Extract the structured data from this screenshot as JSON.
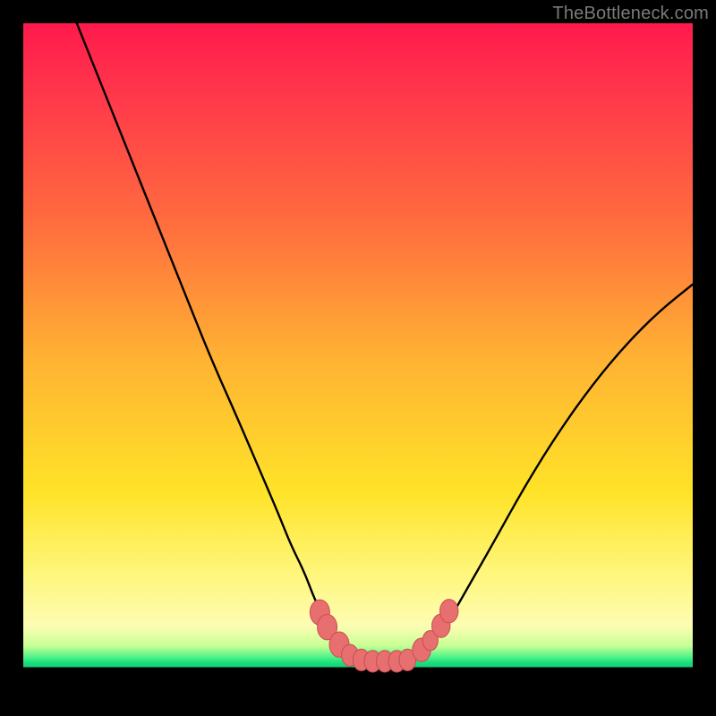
{
  "watermark": "TheBottleneck.com",
  "colors": {
    "background": "#000000",
    "gradient_top": "#ff1a4d",
    "gradient_mid": "#ffe328",
    "gradient_green": "#19e07e",
    "curve_stroke": "#000000",
    "marker_fill": "#e76f6f",
    "marker_stroke": "#c94f50"
  },
  "chart_data": {
    "type": "line",
    "title": "",
    "xlabel": "",
    "ylabel": "",
    "xlim": [
      0,
      100
    ],
    "ylim": [
      0,
      100
    ],
    "series": [
      {
        "name": "left-branch",
        "x": [
          8,
          12,
          16,
          20,
          24,
          28,
          32,
          35,
          38,
          40,
          42,
          43.5,
          45,
          46,
          47,
          48,
          49,
          50
        ],
        "y": [
          100,
          90,
          80,
          70,
          60,
          50,
          41,
          34,
          27,
          22,
          18,
          14,
          11,
          9,
          7,
          6,
          5.2,
          4.8
        ]
      },
      {
        "name": "right-branch",
        "x": [
          58,
          59,
          60,
          62,
          64,
          66,
          70,
          75,
          80,
          85,
          90,
          95,
          100
        ],
        "y": [
          4.8,
          5.3,
          6.2,
          8.5,
          11.5,
          15,
          22,
          31,
          39,
          46,
          52,
          57,
          61
        ]
      },
      {
        "name": "floor",
        "x": [
          50,
          52,
          54,
          56,
          58
        ],
        "y": [
          4.8,
          4.7,
          4.7,
          4.7,
          4.8
        ]
      }
    ],
    "markers": [
      {
        "x": 44.3,
        "y": 12.0,
        "r": 1.4
      },
      {
        "x": 45.4,
        "y": 9.8,
        "r": 1.4
      },
      {
        "x": 47.2,
        "y": 7.2,
        "r": 1.4
      },
      {
        "x": 48.8,
        "y": 5.6,
        "r": 1.2
      },
      {
        "x": 50.5,
        "y": 4.9,
        "r": 1.2
      },
      {
        "x": 52.2,
        "y": 4.7,
        "r": 1.2
      },
      {
        "x": 54.0,
        "y": 4.7,
        "r": 1.2
      },
      {
        "x": 55.8,
        "y": 4.7,
        "r": 1.2
      },
      {
        "x": 57.4,
        "y": 4.9,
        "r": 1.2
      },
      {
        "x": 59.5,
        "y": 6.4,
        "r": 1.3
      },
      {
        "x": 60.8,
        "y": 7.8,
        "r": 1.1
      },
      {
        "x": 62.4,
        "y": 10.0,
        "r": 1.3
      },
      {
        "x": 63.6,
        "y": 12.2,
        "r": 1.3
      }
    ]
  }
}
